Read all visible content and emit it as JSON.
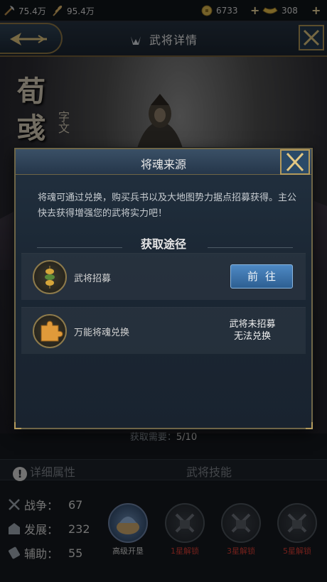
{
  "topbar": {
    "res1": "75.4万",
    "res2": "95.4万",
    "copper": "6733",
    "gold": "308",
    "plus": "+"
  },
  "header": {
    "title": "武将详情"
  },
  "hero": {
    "name_chars": [
      "荀",
      "彧"
    ],
    "courtesy": "字文"
  },
  "bottom": {
    "need_label": "获取需要：",
    "need_value": "5/10",
    "tab_attributes": "详细属性",
    "tab_skills": "武将技能",
    "stats": [
      {
        "label": "战争：",
        "value": "67"
      },
      {
        "label": "发展：",
        "value": "232"
      },
      {
        "label": "辅助：",
        "value": "55"
      }
    ],
    "skills": [
      {
        "label": "高级开垦",
        "locked": false
      },
      {
        "label": "1星解锁",
        "locked": true
      },
      {
        "label": "3星解锁",
        "locked": true
      },
      {
        "label": "5星解锁",
        "locked": true
      }
    ]
  },
  "modal": {
    "title": "将魂来源",
    "desc": "将魂可通过兑换，购买兵书以及大地图势力据点招募获得。主公快去获得增强您的武将实力吧！",
    "section_title": "获取途径",
    "rows": [
      {
        "label": "武将招募",
        "button": "前往"
      },
      {
        "label": "万能将魂兑换",
        "status_line1": "武将未招募",
        "status_line2": "无法兑换"
      }
    ]
  },
  "colors": {
    "accent_gold": "#b49a5b",
    "button_blue": "#3a74ad",
    "locked_red": "#d43b32"
  }
}
